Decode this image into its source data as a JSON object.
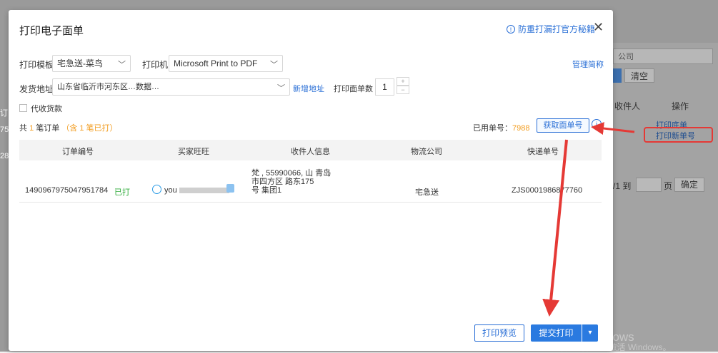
{
  "background": {
    "clear_button": "清空",
    "col_recipient": "收件人",
    "col_action": "操作",
    "link_print_base": "打印底单",
    "link_print_new": "打印新单号",
    "pager_prefix": "/1 到",
    "pager_suffix": "页",
    "confirm_button": "确定",
    "select_placeholder": "公司",
    "left_fragments": [
      "订",
      "75",
      "28"
    ],
    "watermark_line1": "激活 Windows",
    "watermark_line2": "转到\"设置\"以激活 Windows。"
  },
  "modal": {
    "title": "打印电子面单",
    "tip_link": "防重打漏打官方秘籍",
    "template_label": "打印模板",
    "template_value": "宅急送-菜鸟",
    "printer_label": "打印机",
    "printer_value": "Microsoft Print to PDF",
    "manage_link": "管理简称",
    "address_label": "发货地址",
    "address_value": "山东省临沂市河东区…数据…",
    "add_address_link": "新增地址",
    "copies_label": "打印面单数",
    "copies_value": "1",
    "cod_label": "代收货款",
    "summary_prefix": "共",
    "summary_count": "1",
    "summary_mid": "笔订单",
    "summary_printed": "（含 1 笔已打）",
    "used_label": "已用单号：",
    "used_value": "7988",
    "get_number_button": "获取面单号",
    "table": {
      "headers": [
        "订单编号",
        "买家旺旺",
        "收件人信息",
        "物流公司",
        "快递单号"
      ],
      "rows": [
        {
          "order_no": "1490967975047951784",
          "status": "已打",
          "buyer": "you",
          "recipient_line1": "梵 , 55990066, 山 青岛",
          "recipient_line2": "市四方区 路东175",
          "recipient_line3": "号 集团1",
          "logistics": "宅急送",
          "tracking_no": "ZJS0001986877760"
        }
      ]
    },
    "preview_button": "打印预览",
    "submit_button": "提交打印"
  },
  "colors": {
    "primary": "#2a7ae0",
    "link": "#2a6fd6",
    "orange": "#f29c1f",
    "green": "#2eab3a",
    "annotation_red": "#e53935"
  }
}
